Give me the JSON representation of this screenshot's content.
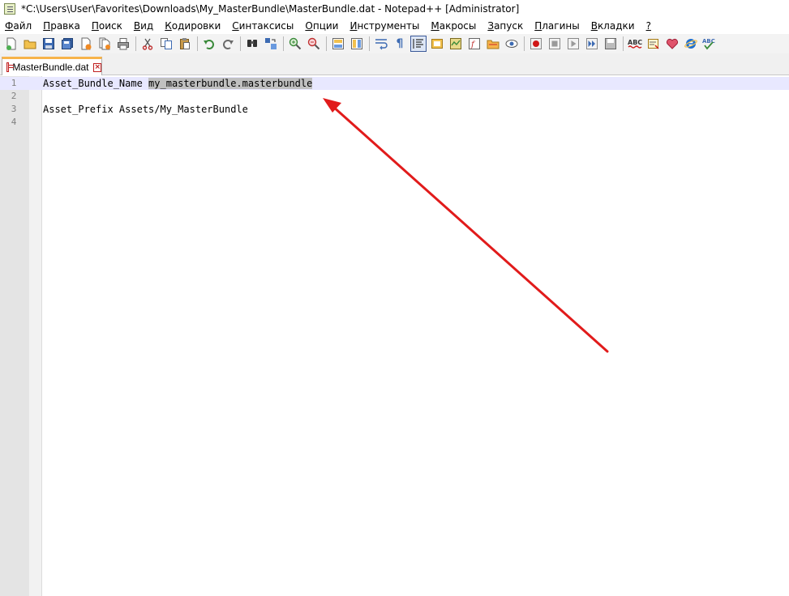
{
  "window": {
    "title": "*C:\\Users\\User\\Favorites\\Downloads\\My_MasterBundle\\MasterBundle.dat - Notepad++ [Administrator]"
  },
  "menu": [
    {
      "label": "Файл",
      "acc": "Ф",
      "rest": "айл"
    },
    {
      "label": "Правка",
      "acc": "П",
      "rest": "равка"
    },
    {
      "label": "Поиск",
      "acc": "П",
      "rest": "оиск"
    },
    {
      "label": "Вид",
      "acc": "В",
      "rest": "ид"
    },
    {
      "label": "Кодировки",
      "acc": "К",
      "rest": "одировки"
    },
    {
      "label": "Синтаксисы",
      "acc": "С",
      "rest": "интаксисы"
    },
    {
      "label": "Опции",
      "acc": "О",
      "rest": "пции"
    },
    {
      "label": "Инструменты",
      "acc": "И",
      "rest": "нструменты"
    },
    {
      "label": "Макросы",
      "acc": "М",
      "rest": "акросы"
    },
    {
      "label": "Запуск",
      "acc": "З",
      "rest": "апуск"
    },
    {
      "label": "Плагины",
      "acc": "П",
      "rest": "лагины"
    },
    {
      "label": "Вкладки",
      "acc": "В",
      "rest": "кладки"
    },
    {
      "label": "?",
      "acc": "?",
      "rest": ""
    }
  ],
  "toolbar": {
    "icons": [
      "new-file-icon",
      "open-file-icon",
      "save-icon",
      "save-all-icon",
      "close-icon",
      "close-all-icon",
      "print-icon",
      "cut-icon",
      "copy-icon",
      "paste-icon",
      "undo-icon",
      "redo-icon",
      "find-icon",
      "replace-icon",
      "zoom-in-icon",
      "zoom-out-icon",
      "sync-vertical-icon",
      "sync-horizontal-icon",
      "word-wrap-icon",
      "show-all-characters-icon",
      "indent-guide-icon",
      "user-language-icon",
      "document-map-icon",
      "function-list-icon",
      "folder-workspace-icon",
      "monitoring-icon",
      "record-macro-icon",
      "stop-record-icon",
      "play-macro-icon",
      "run-macro-multiple-icon",
      "save-macro-icon",
      "spell-check-icon",
      "spell-options-icon",
      "favorite-icon",
      "internet-explorer-icon",
      "auto-spell-icon"
    ],
    "spell_label": "ABC"
  },
  "tab": {
    "label": "MasterBundle.dat"
  },
  "editor": {
    "lines": [
      {
        "number": "1",
        "text": "Asset_Bundle_Name ",
        "selected": "my_masterbundle.masterbundle"
      },
      {
        "number": "2",
        "text": "",
        "selected": ""
      },
      {
        "number": "3",
        "text": "Asset_Prefix Assets/My_MasterBundle",
        "selected": ""
      },
      {
        "number": "4",
        "text": "",
        "selected": ""
      }
    ]
  },
  "annotation": {
    "arrow_color": "#e11b1b"
  }
}
